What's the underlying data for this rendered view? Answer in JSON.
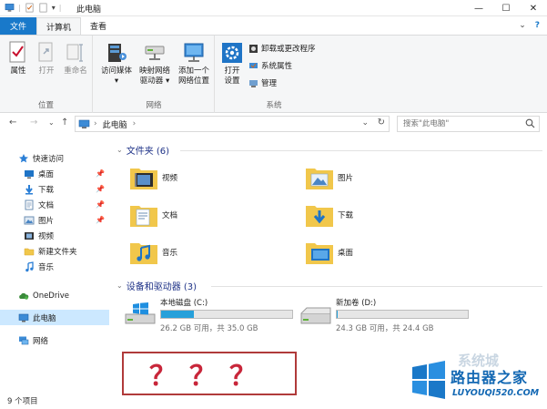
{
  "window": {
    "title": "此电脑"
  },
  "tabs": {
    "file": "文件",
    "computer": "计算机",
    "view": "查看"
  },
  "ribbon": {
    "location": {
      "label": "位置",
      "properties": "属性",
      "open": "打开",
      "rename": "重命名"
    },
    "network": {
      "label": "网络",
      "access_media_1": "访问媒体",
      "access_media_2": "▾",
      "map_drive_1": "映射网络",
      "map_drive_2": "驱动器 ▾",
      "add_location_1": "添加一个",
      "add_location_2": "网络位置"
    },
    "system": {
      "label": "系统",
      "open_settings_1": "打开",
      "open_settings_2": "设置",
      "uninstall": "卸载或更改程序",
      "sys_props": "系统属性",
      "manage": "管理"
    }
  },
  "address": {
    "crumb": "此电脑",
    "sep": "›",
    "search_placeholder": "搜索\"此电脑\""
  },
  "nav": {
    "quick_access": "快速访问",
    "desktop": "桌面",
    "downloads": "下载",
    "documents": "文档",
    "pictures": "图片",
    "videos": "视频",
    "new_folder": "新建文件夹",
    "music": "音乐",
    "onedrive": "OneDrive",
    "this_pc": "此电脑",
    "network": "网络"
  },
  "folders": {
    "header": "文件夹 (6)",
    "items": [
      "视频",
      "图片",
      "文档",
      "下载",
      "音乐",
      "桌面"
    ]
  },
  "drives": {
    "header": "设备和驱动器 (3)",
    "c": {
      "name": "本地磁盘 (C:)",
      "sub": "26.2 GB 可用，共 35.0 GB",
      "used_fraction": 0.25
    },
    "d": {
      "name": "新加卷 (D:)",
      "sub": "24.3 GB 可用，共 24.4 GB",
      "used_fraction": 0.005
    }
  },
  "annotation": "？？？",
  "status": "9 个项目",
  "watermark": {
    "ghost": "系统城",
    "title": "路由器之家",
    "url": "LUYOUQI520.COM"
  },
  "colors": {
    "accent": "#1979ca",
    "drive_fill": "#26a0da",
    "annotation_red": "#c8263a",
    "selection": "#cce8ff"
  }
}
